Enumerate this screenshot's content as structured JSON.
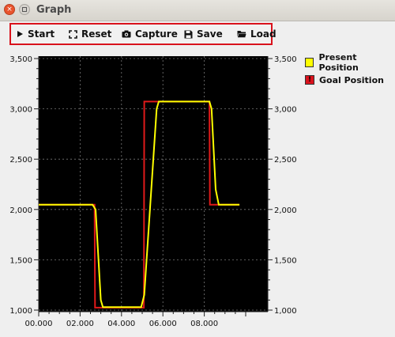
{
  "window": {
    "title": "Graph"
  },
  "toolbar": {
    "buttons": [
      {
        "label": "Start",
        "icon": "play-icon"
      },
      {
        "label": "Reset",
        "icon": "expand-icon"
      },
      {
        "label": "Capture",
        "icon": "camera-icon"
      },
      {
        "label": "Save",
        "icon": "floppy-icon"
      },
      {
        "label": "Load",
        "icon": "folder-icon"
      }
    ]
  },
  "legend": {
    "items": [
      {
        "label": "Present Position",
        "color": "#ffff00"
      },
      {
        "label": "Goal Position",
        "color": "#d9121c"
      }
    ]
  },
  "colors": {
    "toolbar_border": "#d9121c",
    "plot_bg": "#000000",
    "present": "#ffff00",
    "goal": "#e01a1a"
  },
  "chart_data": {
    "type": "line",
    "xlim": [
      0,
      10
    ],
    "ylim": [
      1000,
      3500
    ],
    "x_tick_labels": [
      "00.000",
      "02.000",
      "04.000",
      "06.000",
      "08.000"
    ],
    "x_tick_values": [
      0,
      2,
      4,
      6,
      8
    ],
    "y_tick_labels": [
      "1,000",
      "1,500",
      "2,000",
      "2,500",
      "3,000",
      "3,500"
    ],
    "y_tick_values": [
      1000,
      1500,
      2000,
      2500,
      3000,
      3500
    ],
    "grid": true,
    "legend_position": "top-right",
    "series": [
      {
        "name": "Goal Position",
        "color": "#e01a1a",
        "x": [
          0,
          2.7,
          2.72,
          5.08,
          5.1,
          8.25,
          8.27,
          9.7
        ],
        "y": [
          2048,
          2048,
          1024,
          1024,
          3072,
          3072,
          2048,
          2048
        ]
      },
      {
        "name": "Present Position",
        "color": "#ffff00",
        "x": [
          0,
          2.6,
          2.75,
          3.0,
          3.1,
          4.95,
          5.1,
          5.7,
          5.8,
          8.25,
          8.35,
          8.55,
          8.7,
          9.7
        ],
        "y": [
          2048,
          2048,
          2000,
          1100,
          1030,
          1030,
          1150,
          3000,
          3072,
          3072,
          3000,
          2200,
          2048,
          2048
        ]
      }
    ]
  }
}
